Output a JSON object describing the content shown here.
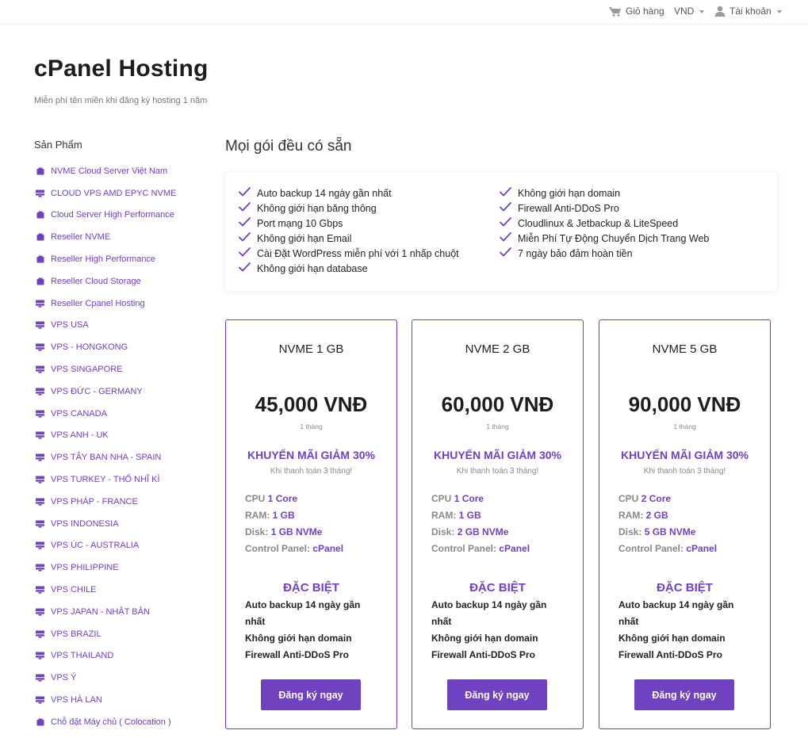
{
  "topbar": {
    "cart_label": "Giỏ hàng",
    "currency_label": "VND",
    "account_label": "Tài khoản"
  },
  "header": {
    "title": "cPanel Hosting",
    "subtitle": "Miễn phí tên miền khi đăng ký hosting 1 năm"
  },
  "sidebar": {
    "heading": "Sản Phẩm",
    "items": [
      {
        "label": "NVME Cloud Server Việt Nam",
        "icon": "box-icon"
      },
      {
        "label": "CLOUD VPS AMD EPYC NVME",
        "icon": "server-icon"
      },
      {
        "label": "Cloud Server High Performance",
        "icon": "box-icon"
      },
      {
        "label": "Reseller NVME",
        "icon": "box-icon"
      },
      {
        "label": "Reseller High Performance",
        "icon": "box-icon"
      },
      {
        "label": "Reseller Cloud Storage",
        "icon": "box-icon"
      },
      {
        "label": "Reseller Cpanel Hosting",
        "icon": "server-icon"
      },
      {
        "label": "VPS USA",
        "icon": "server-icon"
      },
      {
        "label": "VPS - HONGKONG",
        "icon": "server-icon"
      },
      {
        "label": "VPS SINGAPORE",
        "icon": "server-icon"
      },
      {
        "label": "VPS ĐỨC - GERMANY",
        "icon": "server-icon"
      },
      {
        "label": "VPS CANADA",
        "icon": "server-icon"
      },
      {
        "label": "VPS ANH - UK",
        "icon": "server-icon"
      },
      {
        "label": "VPS TÂY BAN NHA - SPAIN",
        "icon": "server-icon"
      },
      {
        "label": "VPS TURKEY - THỔ NHĨ KÌ",
        "icon": "server-icon"
      },
      {
        "label": "VPS PHÁP - FRANCE",
        "icon": "server-icon"
      },
      {
        "label": "VPS INDONESIA",
        "icon": "server-icon"
      },
      {
        "label": "VPS ÚC - AUSTRALIA",
        "icon": "server-icon"
      },
      {
        "label": "VPS PHILIPPINE",
        "icon": "server-icon"
      },
      {
        "label": "VPS CHILE",
        "icon": "server-icon"
      },
      {
        "label": "VPS JAPAN - NHẬT BẢN",
        "icon": "server-icon"
      },
      {
        "label": "VPS BRAZIL",
        "icon": "server-icon"
      },
      {
        "label": "VPS THAILAND",
        "icon": "server-icon"
      },
      {
        "label": "VPS Ý",
        "icon": "server-icon"
      },
      {
        "label": "VPS HÀ LAN",
        "icon": "server-icon"
      },
      {
        "label": "Chỗ đặt Máy chủ ( Colocation )",
        "icon": "box-icon"
      }
    ]
  },
  "features": {
    "title": "Mọi gói đều có sẵn",
    "col1": [
      "Auto backup 14 ngày gần nhất",
      "Không giới hạn băng thông",
      "Port mạng 10 Gbps",
      "Không giới hạn Email",
      "Cài Đặt WordPress miễn phí với 1 nhấp chuột",
      "Không giới hạn database"
    ],
    "col2": [
      "Không giới hạn domain",
      "Firewall Anti-DDoS Pro",
      "Cloudlinux & Jetbackup & LiteSpeed",
      "Miễn Phí Tự Động Chuyển Dịch Trang Web",
      "7 ngày bảo đảm hoàn tiền"
    ]
  },
  "plans": [
    {
      "name": "NVME 1 GB",
      "price": "45,000 VNĐ",
      "cycle": "1 tháng",
      "promo": "KHUYẾN MÃI GIẢM 30%",
      "promo_note": "Khi thanh toán 3 tháng!",
      "cpu_label": "CPU",
      "cpu_value": "1 Core",
      "ram_label": "RAM:",
      "ram_value": "1 GB",
      "disk_label": "Disk:",
      "disk_value": "1 GB NVMe",
      "panel_label": "Control Panel:",
      "panel_value": "cPanel",
      "special_title": "ĐẶC BIỆT",
      "special": [
        "Auto backup 14 ngày gần nhất",
        "Không giới hạn domain",
        "Firewall Anti-DDoS Pro"
      ],
      "button": "Đăng ký ngay"
    },
    {
      "name": "NVME 2 GB",
      "price": "60,000 VNĐ",
      "cycle": "1 tháng",
      "promo": "KHUYẾN MÃI GIẢM 30%",
      "promo_note": "Khi thanh toán 3 tháng!",
      "cpu_label": "CPU",
      "cpu_value": "1 Core",
      "ram_label": "RAM:",
      "ram_value": "1 GB",
      "disk_label": "Disk:",
      "disk_value": "2 GB NVMe",
      "panel_label": "Control Panel:",
      "panel_value": "cPanel",
      "special_title": "ĐẶC BIỆT",
      "special": [
        "Auto backup 14 ngày gần nhất",
        "Không giới hạn domain",
        "Firewall Anti-DDoS Pro"
      ],
      "button": "Đăng ký ngay"
    },
    {
      "name": "NVME 5 GB",
      "price": "90,000 VNĐ",
      "cycle": "1 tháng",
      "promo": "KHUYẾN MÃI GIẢM 30%",
      "promo_note": "Khi thanh toán 3 tháng!",
      "cpu_label": "CPU",
      "cpu_value": "2 Core",
      "ram_label": "RAM:",
      "ram_value": "2 GB",
      "disk_label": "Disk:",
      "disk_value": "5 GB NVMe",
      "panel_label": "Control Panel:",
      "panel_value": "cPanel",
      "special_title": "ĐẶC BIỆT",
      "special": [
        "Auto backup 14 ngày gần nhất",
        "Không giới hạn domain",
        "Firewall Anti-DDoS Pro"
      ],
      "button": "Đăng ký ngay"
    }
  ],
  "colors": {
    "accent": "#6f42c1",
    "text": "#222222",
    "muted": "#888888"
  }
}
